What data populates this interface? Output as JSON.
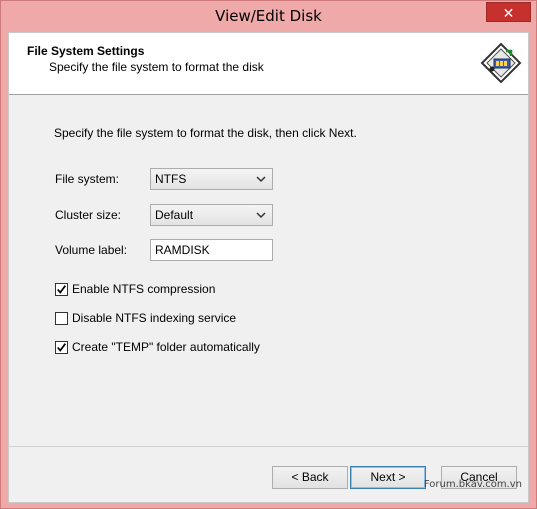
{
  "window": {
    "title": "View/Edit Disk",
    "close_label": "✕"
  },
  "header": {
    "title": "File System Settings",
    "subtitle": "Specify the file system to format the disk"
  },
  "content": {
    "instructions": "Specify the file system to format the disk, then click Next.",
    "file_system": {
      "label": "File system:",
      "value": "NTFS"
    },
    "cluster_size": {
      "label": "Cluster size:",
      "value": "Default"
    },
    "volume_label": {
      "label": "Volume label:",
      "value": "RAMDISK"
    },
    "options": [
      {
        "label": "Enable NTFS compression",
        "checked": true
      },
      {
        "label": "Disable NTFS indexing service",
        "checked": false
      },
      {
        "label": "Create \"TEMP\" folder automatically",
        "checked": true
      }
    ]
  },
  "buttons": {
    "back": "< Back",
    "next": "Next >",
    "cancel": "Cancel"
  },
  "watermark": "Forum.bkav.com.vn",
  "colors": {
    "title_bar": "#f0a9a9",
    "close_button": "#c7312d",
    "dialog_bg": "#f0f0f0"
  }
}
